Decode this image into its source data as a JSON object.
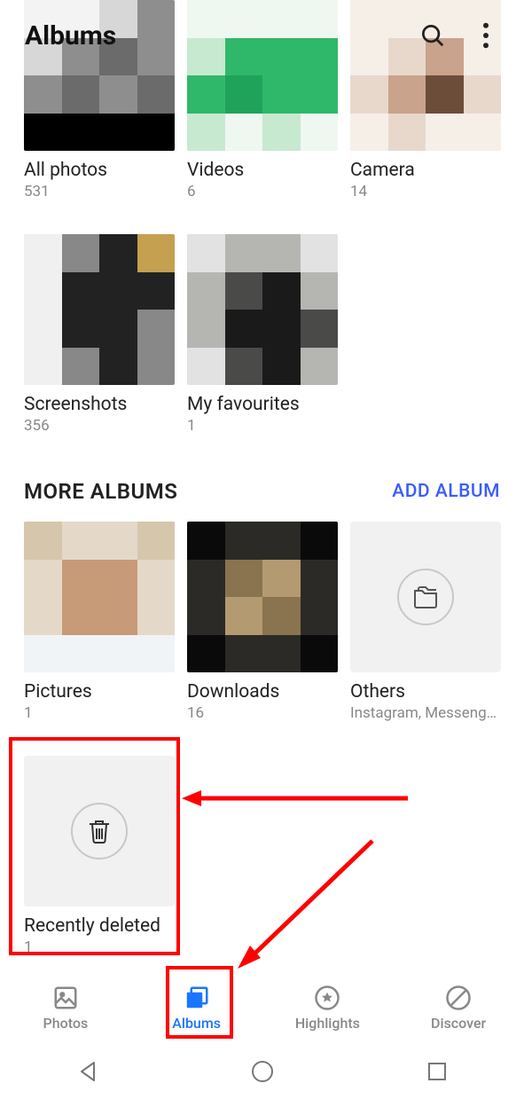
{
  "header": {
    "title": "Albums"
  },
  "albums_main": [
    {
      "title": "All photos",
      "count": "531"
    },
    {
      "title": "Videos",
      "count": "6"
    },
    {
      "title": "Camera",
      "count": "14"
    },
    {
      "title": "Screenshots",
      "count": "356"
    },
    {
      "title": "My favourites",
      "count": "1"
    }
  ],
  "more_section": {
    "heading": "MORE ALBUMS",
    "add_label": "ADD ALBUM"
  },
  "albums_more": [
    {
      "title": "Pictures",
      "count": "1"
    },
    {
      "title": "Downloads",
      "count": "16"
    },
    {
      "title": "Others",
      "subtitle": "Instagram, Messenge…"
    },
    {
      "title": "Recently deleted",
      "count": "1"
    }
  ],
  "nav": {
    "photos": "Photos",
    "albums": "Albums",
    "highlights": "Highlights",
    "discover": "Discover"
  }
}
